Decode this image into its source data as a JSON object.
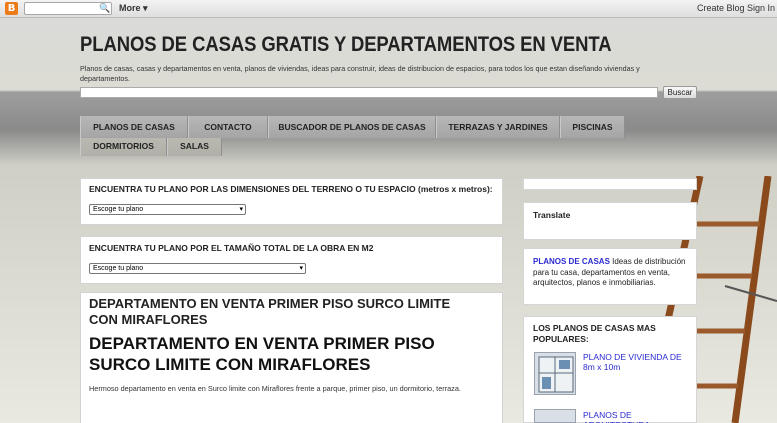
{
  "navbar": {
    "logo": "B",
    "more": "More",
    "create_blog": "Create Blog",
    "sign_in": "Sign In"
  },
  "header": {
    "title": "PLANOS DE CASAS GRATIS Y DEPARTAMENTOS EN VENTA",
    "description": "Planos de casas, casas y departamentos en venta, planos de viviendas, ideas para construir, ideas de distribucion de espacios, para todos los que estan diseñando viviendas y departamentos.",
    "search_button": "Buscar"
  },
  "tabs": [
    "PLANOS DE CASAS",
    "CONTACTO",
    "BUSCADOR DE PLANOS DE CASAS",
    "TERRAZAS Y JARDINES",
    "PISCINAS",
    "DORMITORIOS",
    "SALAS"
  ],
  "widgets": {
    "dimensiones": {
      "title": "ENCUENTRA TU PLANO POR LAS DIMENSIONES DEL TERRENO O TU ESPACIO (metros x metros):",
      "select": "Escoge tu plano"
    },
    "tamano": {
      "title": "ENCUENTRA TU PLANO POR EL TAMAÑO TOTAL DE LA OBRA EN M2",
      "select": "Escoge tu plano"
    }
  },
  "post": {
    "header": "DEPARTAMENTO EN VENTA PRIMER PISO SURCO LIMITE CON MIRAFLORES",
    "title": "DEPARTAMENTO EN VENTA PRIMER PISO SURCO LIMITE CON MIRAFLORES",
    "body": "Hermoso departamento en venta en Surco limite con Miraflores frente a parque, primer piso, un dormitorio, terraza."
  },
  "sidebar": {
    "translate": "Translate",
    "about_link": "PLANOS DE CASAS",
    "about_text": " Ideas de distribución para tu casa, departamentos en venta, arquitectos, planos e inmobiliarias.",
    "popular_title": "LOS PLANOS DE CASAS MAS POPULARES:",
    "popular": [
      "PLANO DE VIVIENDA DE 8m x 10m",
      "PLANOS DE ARQUITECTURA"
    ]
  }
}
